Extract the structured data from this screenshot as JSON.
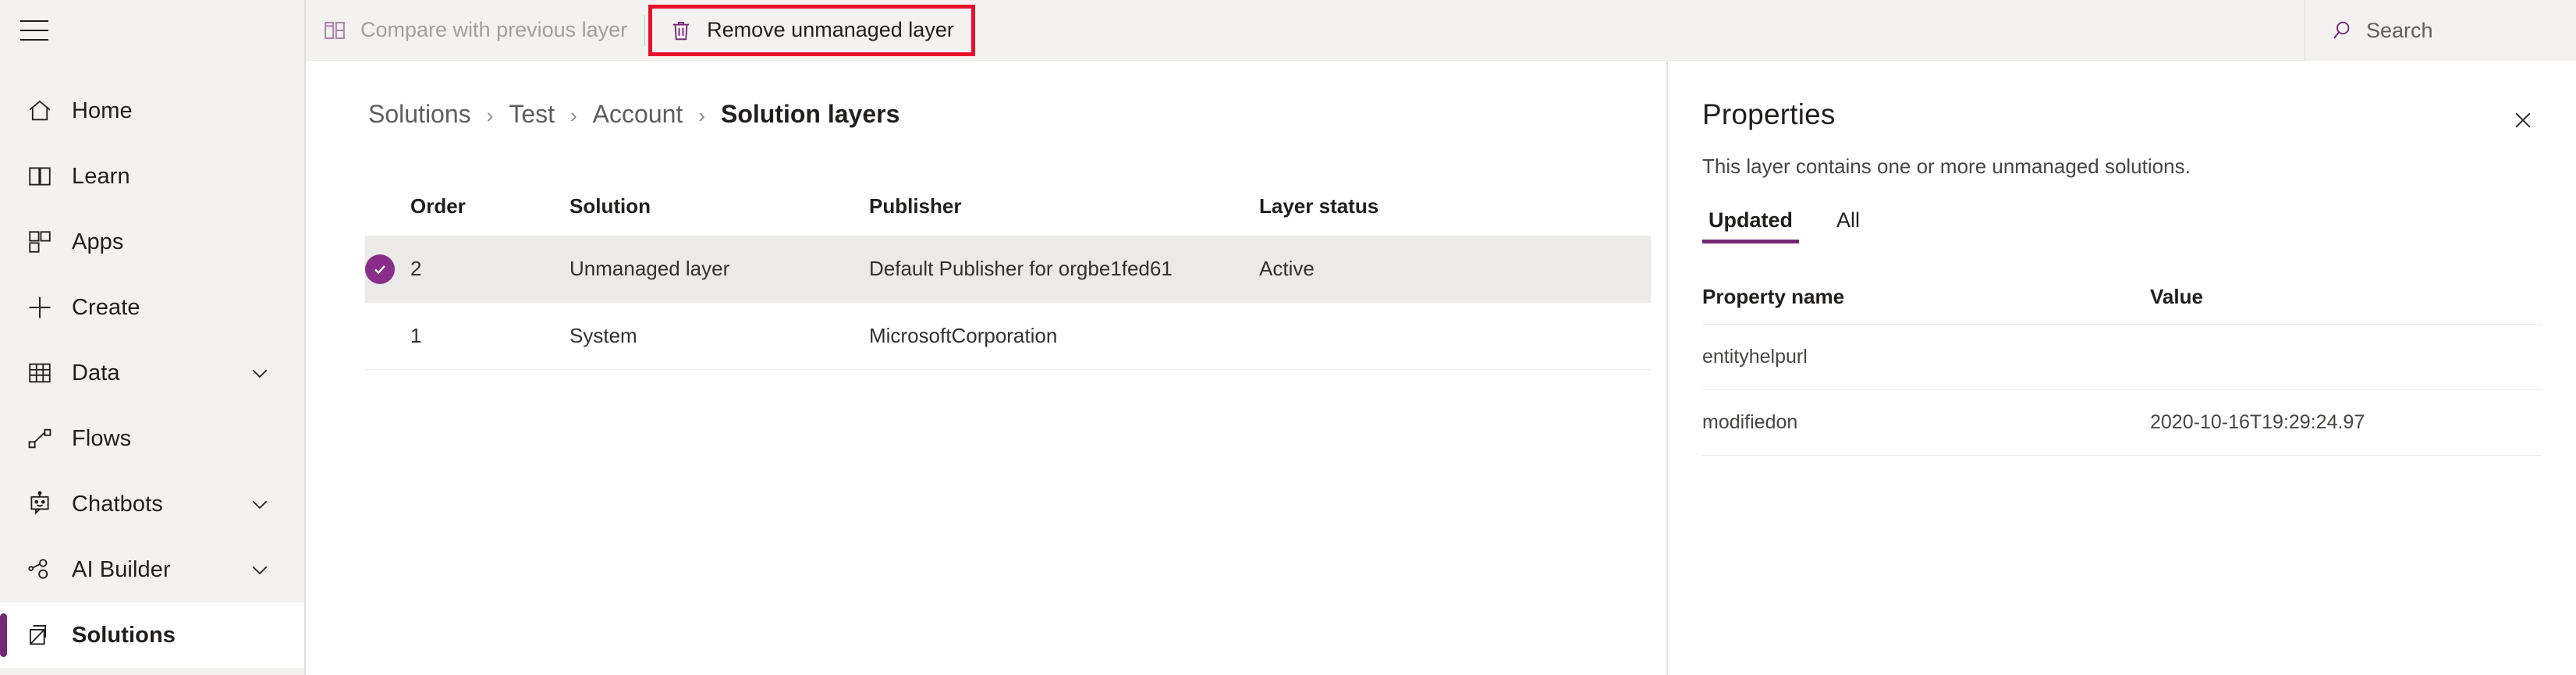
{
  "sidebar": {
    "menu_icon": "hamburger-icon",
    "items": [
      {
        "label": "Home",
        "icon": "home-icon",
        "chevron": false,
        "active": false
      },
      {
        "label": "Learn",
        "icon": "book-icon",
        "chevron": false,
        "active": false
      },
      {
        "label": "Apps",
        "icon": "apps-grid-icon",
        "chevron": false,
        "active": false
      },
      {
        "label": "Create",
        "icon": "plus-icon",
        "chevron": false,
        "active": false
      },
      {
        "label": "Data",
        "icon": "table-icon",
        "chevron": true,
        "active": false
      },
      {
        "label": "Flows",
        "icon": "flows-icon",
        "chevron": true,
        "active": false
      },
      {
        "label": "Chatbots",
        "icon": "chatbot-icon",
        "chevron": true,
        "active": false
      },
      {
        "label": "AI Builder",
        "icon": "ai-builder-icon",
        "chevron": true,
        "active": false
      },
      {
        "label": "Solutions",
        "icon": "solutions-icon",
        "chevron": false,
        "active": true
      }
    ]
  },
  "commandbar": {
    "compare_label": "Compare with previous layer",
    "compare_icon": "compare-layers-icon",
    "compare_disabled": true,
    "remove_label": "Remove unmanaged layer",
    "remove_icon": "trash-icon",
    "remove_highlighted": true,
    "highlight_color": "#e8112d"
  },
  "search": {
    "placeholder": "Search",
    "icon": "search-icon",
    "value": ""
  },
  "breadcrumb": {
    "separator": "›",
    "items": [
      {
        "label": "Solutions",
        "current": false
      },
      {
        "label": "Test",
        "current": false
      },
      {
        "label": "Account",
        "current": false
      },
      {
        "label": "Solution layers",
        "current": true
      }
    ]
  },
  "layers_table": {
    "columns": [
      "Order",
      "Solution",
      "Publisher",
      "Layer status"
    ],
    "rows": [
      {
        "selected": true,
        "order": "2",
        "solution": "Unmanaged layer",
        "publisher": "Default Publisher for orgbe1fed61",
        "status": "Active"
      },
      {
        "selected": false,
        "order": "1",
        "solution": "System",
        "publisher": "MicrosoftCorporation",
        "status": ""
      }
    ]
  },
  "properties_panel": {
    "title": "Properties",
    "description": "This layer contains one or more unmanaged solutions.",
    "close_icon": "close-icon",
    "tabs": [
      {
        "label": "Updated",
        "active": true
      },
      {
        "label": "All",
        "active": false
      }
    ],
    "columns": [
      "Property name",
      "Value"
    ],
    "rows": [
      {
        "name": "entityhelpurl",
        "value": ""
      },
      {
        "name": "modifiedon",
        "value": "2020-10-16T19:29:24.97"
      }
    ]
  },
  "colors": {
    "accent": "#742774",
    "selection": "#8a2d8a",
    "highlight": "#e8112d",
    "chrome": "#f3f2f1"
  }
}
